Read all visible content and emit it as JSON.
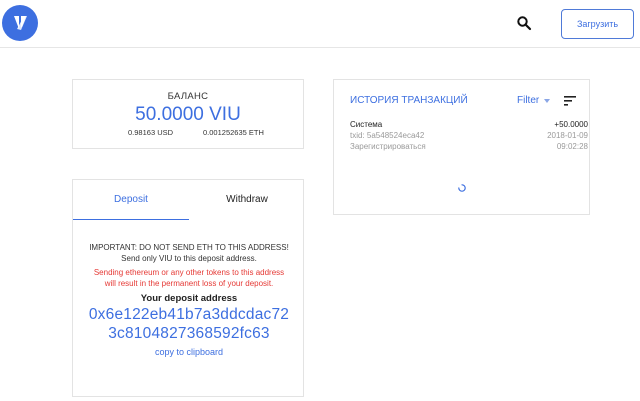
{
  "header": {
    "logo_icon": "vibe-logo-icon",
    "search_icon": "search-icon",
    "upload_label": "Загрузить",
    "accent_color": "#3d6fe0"
  },
  "balance": {
    "title": "БАЛАНС",
    "value": "50.0000 VIU",
    "usd": "0.98163 USD",
    "eth": "0.001252635 ETH"
  },
  "deposit": {
    "tabs": [
      {
        "label": "Deposit",
        "active": true
      },
      {
        "label": "Withdraw",
        "active": false
      }
    ],
    "important_line1": "IMPORTANT: DO NOT SEND ETH TO THIS ADDRESS!",
    "important_line2": "Send only VIU to this deposit address.",
    "warning_line1": "Sending ethereum or any other tokens to this address",
    "warning_line2": "will result in the permanent loss of your deposit.",
    "address_title": "Your deposit address",
    "address_line1": "0x6e122eb41b7a3ddcdac72",
    "address_line2": "3c8104827368592fc63",
    "copy_label": "copy to clipboard",
    "warning_color": "#e53935"
  },
  "transactions": {
    "title": "ИСТОРИЯ ТРАНЗАКЦИЙ",
    "filter_label": "Filter",
    "sort_icon": "sort-icon",
    "items": [
      {
        "source": "Система",
        "txid": "txid: 5a548524eca42",
        "type": "Зарегистрироваться",
        "amount": "+50.0000",
        "date": "2018-01-09",
        "time": "09:02:28"
      }
    ],
    "loading_icon": "spinner-icon"
  }
}
